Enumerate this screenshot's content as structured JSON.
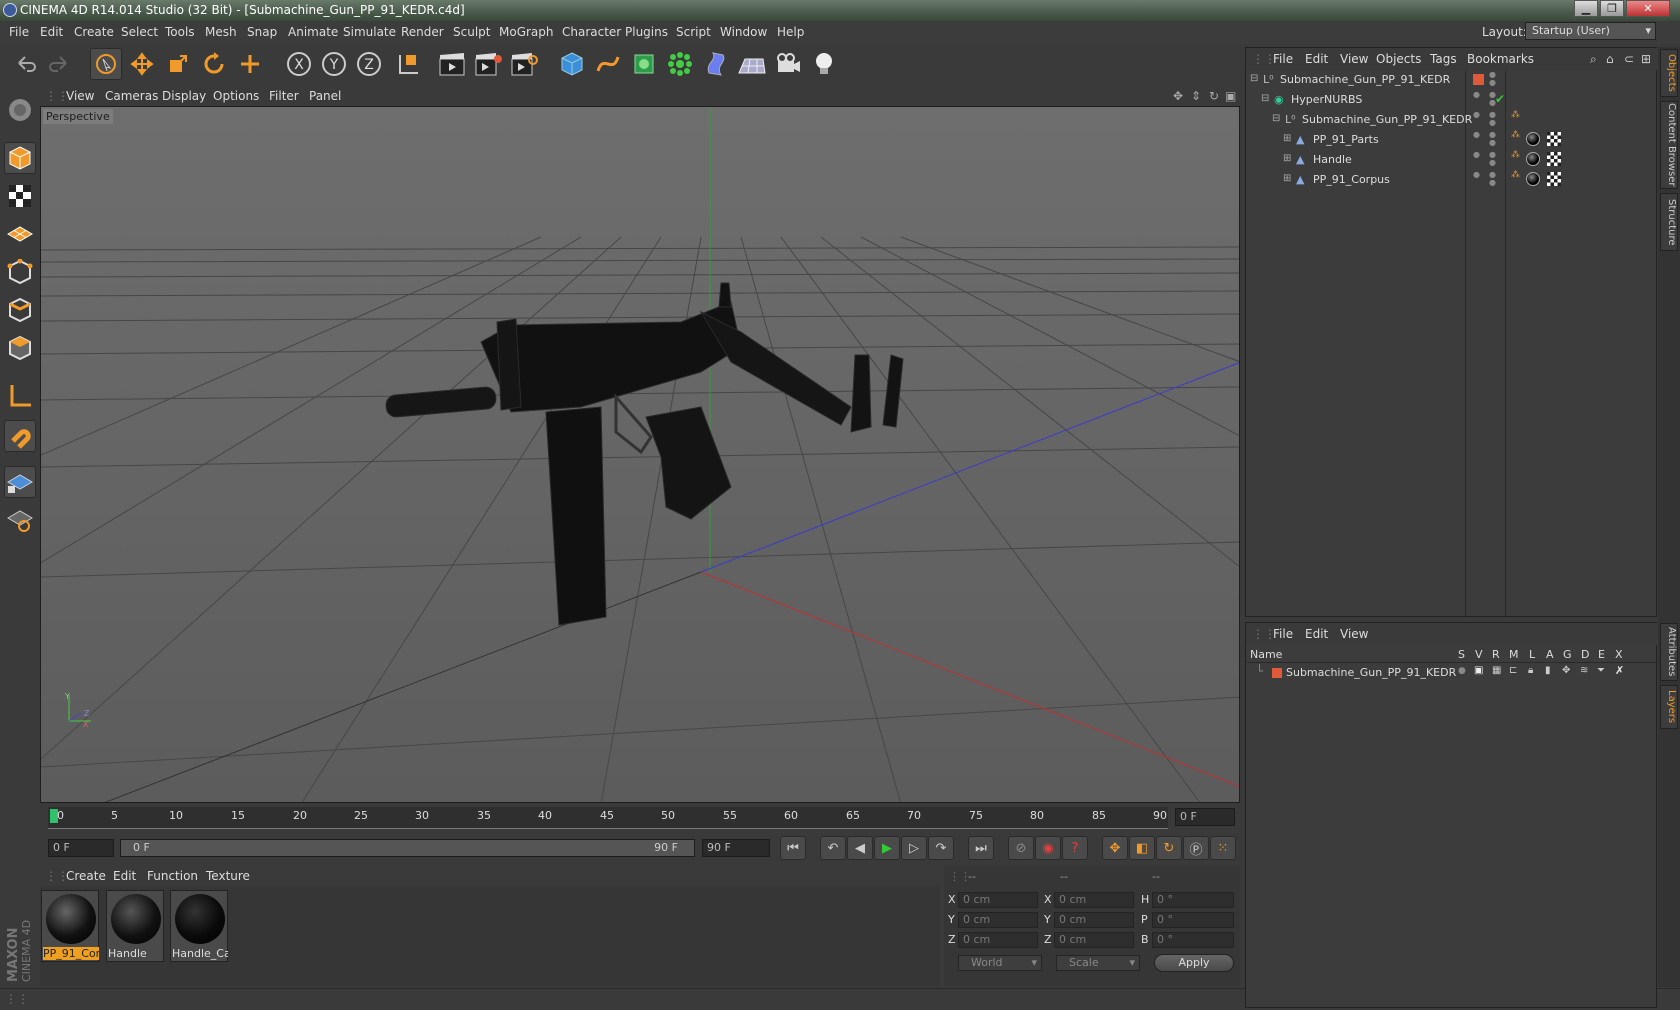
{
  "window": {
    "title": "CINEMA 4D R14.014 Studio (32 Bit) - [Submachine_Gun_PP_91_KEDR.c4d]",
    "minimize": "▁",
    "maximize": "❐",
    "close": "✕"
  },
  "menubar": {
    "items": [
      "File",
      "Edit",
      "Create",
      "Select",
      "Tools",
      "Mesh",
      "Snap",
      "Animate",
      "Simulate",
      "Render",
      "Sculpt",
      "MoGraph",
      "Character",
      "Plugins",
      "Script",
      "Window",
      "Help"
    ],
    "layout_label": "Layout:",
    "layout_value": "Startup (User)"
  },
  "toolbar": {
    "icons": [
      "undo-icon",
      "redo-icon",
      "live-selection-icon",
      "move-icon",
      "scale-icon",
      "rotate-icon",
      "add-icon",
      "x-axis-icon",
      "y-axis-icon",
      "z-axis-icon",
      "coordinate-system-icon",
      "render-view-icon",
      "render-picture-viewer-icon",
      "edit-render-settings-icon",
      "cube-icon",
      "spline-pen-icon",
      "nurbs-icon",
      "array-icon",
      "deformer-icon",
      "floor-icon",
      "camera-icon",
      "light-icon"
    ],
    "axis_labels": [
      "X",
      "Y",
      "Z"
    ]
  },
  "left_toolbar": {
    "icons": [
      "make-editable-icon",
      "model-mode-icon",
      "texture-mode-icon",
      "workplane-icon",
      "points-mode-icon",
      "edges-mode-icon",
      "polygons-mode-icon",
      "axis-mode-icon",
      "magnet-icon",
      "locked-workplane-icon",
      "snap-settings-icon"
    ]
  },
  "viewport": {
    "menu": [
      "View",
      "Cameras",
      "Display",
      "Options",
      "Filter",
      "Panel"
    ],
    "label": "Perspective",
    "axis_y": "Y",
    "axis_x": "X",
    "axis_z": "Z"
  },
  "timeline": {
    "ticks": [
      "0",
      "5",
      "10",
      "15",
      "20",
      "25",
      "30",
      "35",
      "40",
      "45",
      "50",
      "55",
      "60",
      "65",
      "70",
      "75",
      "80",
      "85",
      "90"
    ],
    "current_frame": "0 F",
    "start_field": "0 F",
    "range_start": "0 F",
    "range_end": "90 F",
    "end_field": "90 F"
  },
  "transport": {
    "icons": [
      "go-to-start-icon",
      "previous-key-icon",
      "step-back-icon",
      "play-icon",
      "step-forward-icon",
      "next-key-icon",
      "go-to-end-icon",
      "record-icon",
      "autokey-icon",
      "keyframe-help-icon",
      "move-key-icon",
      "scale-key-icon",
      "rotate-key-icon",
      "param-key-icon",
      "pla-key-icon",
      "timeline-icon"
    ]
  },
  "material_manager": {
    "menu": [
      "Create",
      "Edit",
      "Function",
      "Texture"
    ],
    "materials": [
      {
        "name": "PP_91_Corp",
        "selected": true
      },
      {
        "name": "Handle",
        "selected": false
      },
      {
        "name": "Handle_Ca",
        "selected": false
      }
    ]
  },
  "coordinates": {
    "header": [
      "--",
      "--",
      "--"
    ],
    "rows": [
      {
        "l1": "X",
        "v1": "0 cm",
        "l2": "X",
        "v2": "0 cm",
        "l3": "H",
        "v3": "0 °"
      },
      {
        "l1": "Y",
        "v1": "0 cm",
        "l2": "Y",
        "v2": "0 cm",
        "l3": "P",
        "v3": "0 °"
      },
      {
        "l1": "Z",
        "v1": "0 cm",
        "l2": "Z",
        "v2": "0 cm",
        "l3": "B",
        "v3": "0 °"
      }
    ],
    "space": "World",
    "mode": "Scale",
    "apply": "Apply"
  },
  "brand": {
    "line1": "MAXON",
    "line2": "CINEMA 4D"
  },
  "object_manager": {
    "menu": [
      "File",
      "Edit",
      "View",
      "Objects",
      "Tags",
      "Bookmarks"
    ],
    "objects": [
      {
        "name": "Submachine_Gun_PP_91_KEDR",
        "depth": 0,
        "icon": "null-object-icon"
      },
      {
        "name": "HyperNURBS",
        "depth": 1,
        "icon": "hypernurbs-icon"
      },
      {
        "name": "Submachine_Gun_PP_91_KEDR",
        "depth": 2,
        "icon": "null-object-icon"
      },
      {
        "name": "PP_91_Parts",
        "depth": 3,
        "icon": "polygon-object-icon"
      },
      {
        "name": "Handle",
        "depth": 3,
        "icon": "polygon-object-icon"
      },
      {
        "name": "PP_91_Corpus",
        "depth": 3,
        "icon": "polygon-object-icon"
      }
    ]
  },
  "layer_manager": {
    "menu": [
      "File",
      "Edit",
      "View"
    ],
    "columns": [
      "Name",
      "S",
      "V",
      "R",
      "M",
      "L",
      "A",
      "G",
      "D",
      "E",
      "X"
    ],
    "layers": [
      {
        "name": "Submachine_Gun_PP_91_KEDR",
        "color": "#e05a3a"
      }
    ]
  },
  "side_tabs": [
    "Objects",
    "Content Browser",
    "Structure",
    "Attributes",
    "Layers"
  ],
  "colors": {
    "accent": "#f09a2b",
    "selection_bg": "#f0a020",
    "layer": "#e05a3a"
  }
}
